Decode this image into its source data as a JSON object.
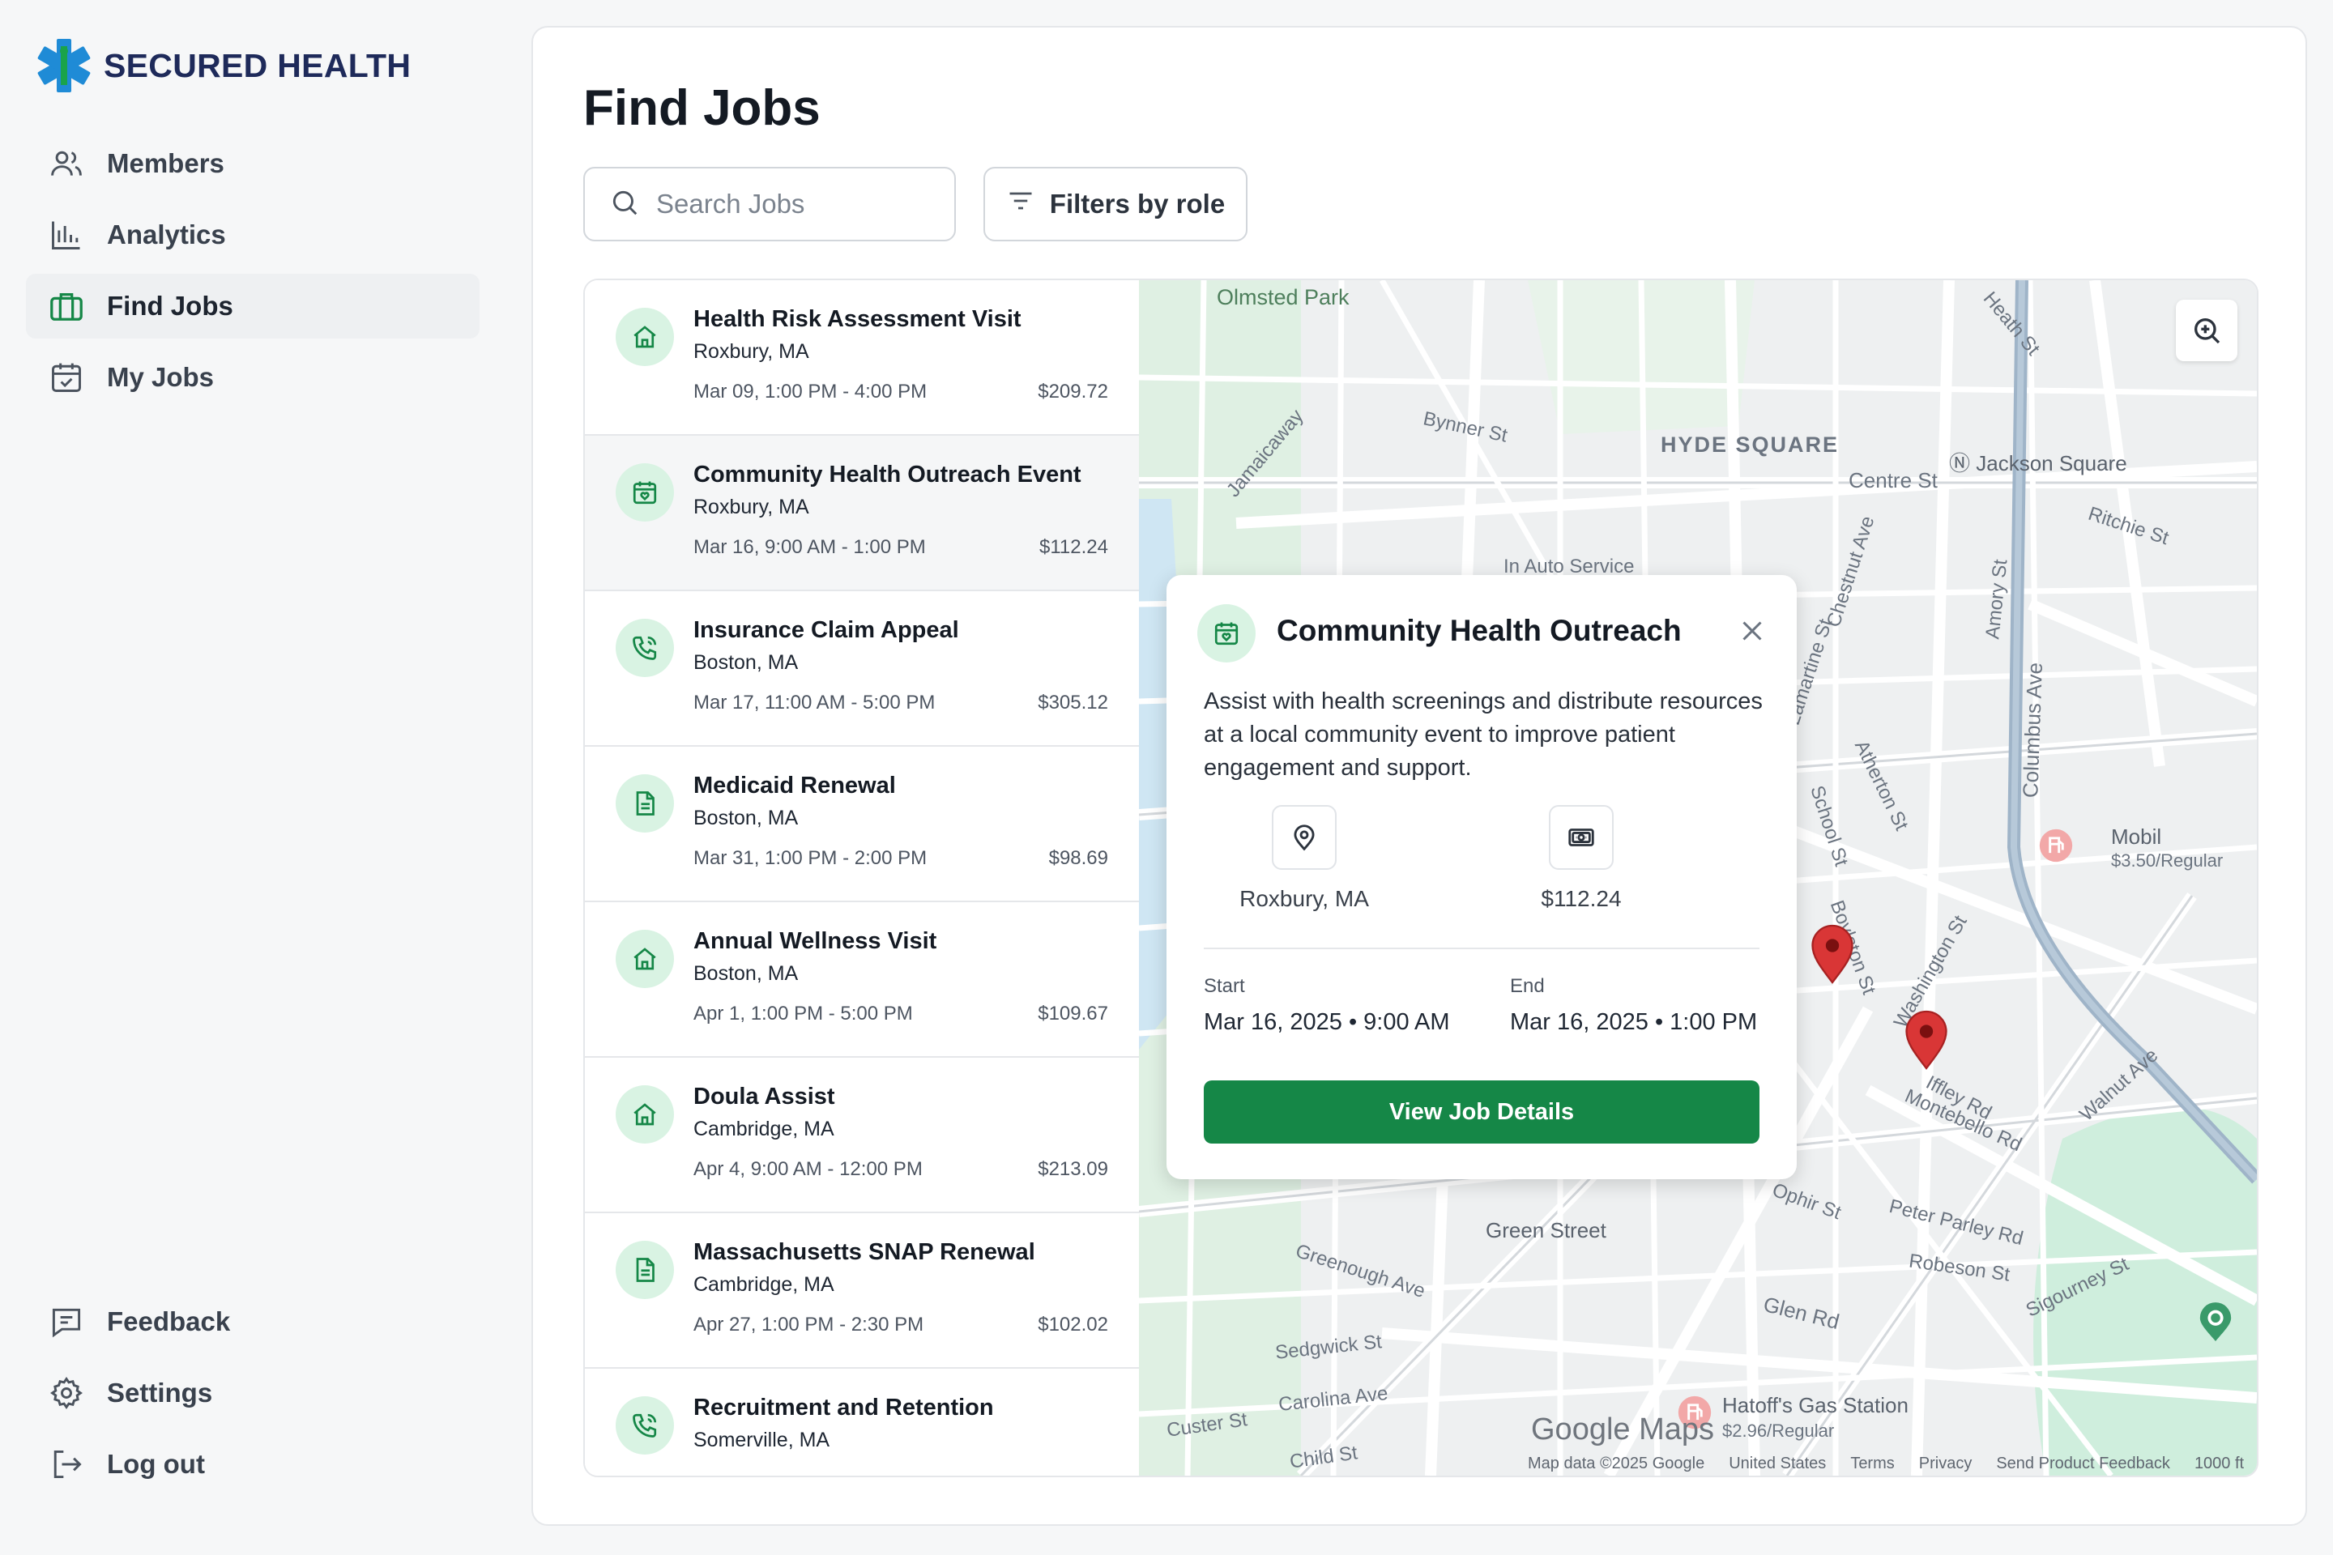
{
  "brand": {
    "name": "SECURED HEALTH"
  },
  "nav": {
    "items": [
      {
        "label": "Members",
        "icon": "users-icon"
      },
      {
        "label": "Analytics",
        "icon": "bar-chart-icon"
      },
      {
        "label": "Find Jobs",
        "icon": "briefcase-icon",
        "active": true
      },
      {
        "label": "My Jobs",
        "icon": "calendar-check-icon"
      }
    ],
    "bottom": [
      {
        "label": "Feedback",
        "icon": "message-icon"
      },
      {
        "label": "Settings",
        "icon": "gear-icon"
      },
      {
        "label": "Log out",
        "icon": "logout-icon"
      }
    ]
  },
  "page": {
    "title": "Find Jobs",
    "search_placeholder": "Search Jobs",
    "filter_label": "Filters by role"
  },
  "jobs": [
    {
      "title": "Health Risk Assessment Visit",
      "location": "Roxbury, MA",
      "time": "Mar 09, 1:00 PM - 4:00 PM",
      "pay": "$209.72",
      "icon": "home-icon"
    },
    {
      "title": "Community Health Outreach Event",
      "location": "Roxbury, MA",
      "time": "Mar 16, 9:00 AM - 1:00 PM",
      "pay": "$112.24",
      "icon": "calendar-heart-icon",
      "selected": true
    },
    {
      "title": "Insurance Claim Appeal",
      "location": "Boston, MA",
      "time": "Mar 17, 11:00 AM - 5:00 PM",
      "pay": "$305.12",
      "icon": "phone-icon"
    },
    {
      "title": "Medicaid Renewal",
      "location": "Boston, MA",
      "time": "Mar 31, 1:00 PM - 2:00 PM",
      "pay": "$98.69",
      "icon": "document-icon"
    },
    {
      "title": "Annual Wellness Visit",
      "location": "Boston, MA",
      "time": "Apr 1, 1:00 PM - 5:00 PM",
      "pay": "$109.67",
      "icon": "home-icon"
    },
    {
      "title": "Doula Assist",
      "location": "Cambridge, MA",
      "time": "Apr 4, 9:00 AM - 12:00 PM",
      "pay": "$213.09",
      "icon": "home-icon"
    },
    {
      "title": "Massachusetts SNAP Renewal",
      "location": "Cambridge, MA",
      "time": "Apr 27, 1:00 PM - 2:30 PM",
      "pay": "$102.02",
      "icon": "document-icon"
    },
    {
      "title": "Recruitment and Retention",
      "location": "Somerville, MA",
      "time": "",
      "pay": "",
      "icon": "phone-icon"
    }
  ],
  "popup": {
    "title": "Community Health Outreach",
    "description": "Assist with health screenings and distribute resources at a local community event to improve patient engagement and support.",
    "location": "Roxbury, MA",
    "pay": "$112.24",
    "start_label": "Start",
    "start": "Mar 16, 2025 • 9:00 AM",
    "end_label": "End",
    "end": "Mar 16, 2025 • 1:00 PM",
    "button": "View Job Details"
  },
  "map": {
    "labels": {
      "olmsted": "Olmsted Park",
      "hyde": "HYDE SQUARE",
      "jackson": "Jackson Square",
      "centre": "Centre St",
      "bynner": "Bynner St",
      "jamaicaway": "Jamaicaway",
      "ritchie": "Ritchie St",
      "auto": "In Auto Service",
      "mobil": "Mobil",
      "mobil_price": "$3.50/Regular",
      "green": "Green Street",
      "glen": "Glen Rd",
      "hatoff": "Hatoff's Gas Station",
      "hatoff_price": "$2.96/Regular",
      "sedgwick": "Sedgwick St",
      "carolina": "Carolina Ave",
      "child": "Child St",
      "custer": "Custer St",
      "peter": "Peter Parley Rd",
      "robeson": "Robeson St",
      "montebello": "Montebello Rd",
      "iffley": "Iffley Rd",
      "ophir": "Ophir St",
      "greenough": "Greenough Ave",
      "columbus": "Columbus Ave",
      "washington": "Washington St",
      "boylston": "Boylston St",
      "school": "School St",
      "atherton": "Atherton St",
      "amory": "Amory St",
      "lamartine": "Lamartine St",
      "chestnut": "Chestnut Ave",
      "heath": "Heath St",
      "walnut": "Walnut Ave",
      "sigourney": "Sigourney St"
    },
    "logo": "Google Maps",
    "footer": [
      "Map data ©2025 Google",
      "United States",
      "Terms",
      "Privacy",
      "Send Product Feedback",
      "1000 ft"
    ]
  },
  "colors": {
    "brand": "#1e2a5a",
    "accent": "#158747",
    "icon_bg": "#d9f3e3",
    "pin": "#d93636"
  }
}
